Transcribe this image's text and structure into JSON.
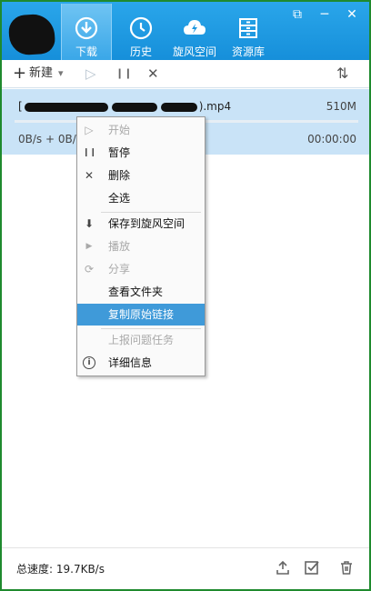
{
  "header": {
    "tabs": [
      {
        "label": "下载",
        "icon": "download-icon"
      },
      {
        "label": "历史",
        "icon": "clock-icon"
      },
      {
        "label": "旋风空间",
        "icon": "cloud-icon"
      },
      {
        "label": "资源库",
        "icon": "cabinet-icon"
      }
    ],
    "controls": {
      "skin": "⧉",
      "minimize": "─",
      "close": "✕"
    }
  },
  "toolbar": {
    "new_label": "新建",
    "new_plus": "+",
    "dropdown": "▾",
    "start": "▷",
    "pause": "❙❙",
    "delete": "✕",
    "sort": "⇅"
  },
  "task": {
    "name_prefix": "[",
    "name_suffix": ").mp4",
    "size": "510M",
    "speed": "0B/s + 0B/s",
    "time_remaining": "00:00:00",
    "progress_percent": 0
  },
  "menu": {
    "items": [
      {
        "label": "开始",
        "icon": "▷",
        "disabled": true
      },
      {
        "label": "暂停",
        "icon": "❙❙",
        "disabled": false
      },
      {
        "label": "删除",
        "icon": "✕",
        "disabled": false
      },
      {
        "label": "全选",
        "icon": "",
        "disabled": false
      },
      {
        "label": "保存到旋风空间",
        "icon": "⬇",
        "disabled": false
      },
      {
        "label": "播放",
        "icon": "▶",
        "disabled": true
      },
      {
        "label": "分享",
        "icon": "⟳",
        "disabled": true
      },
      {
        "label": "查看文件夹",
        "icon": "",
        "disabled": false
      },
      {
        "label": "复制原始链接",
        "icon": "",
        "disabled": false,
        "highlighted": true
      },
      {
        "label": "上报问题任务",
        "icon": "",
        "disabled": true
      },
      {
        "label": "详细信息",
        "icon": "i",
        "disabled": false
      }
    ]
  },
  "status": {
    "total_speed": "总速度: 19.7KB/s"
  },
  "colors": {
    "header": "#1b96de",
    "highlight": "#3f9ad9",
    "task_row": "#c9e3f7",
    "border": "#1f8a2e"
  }
}
